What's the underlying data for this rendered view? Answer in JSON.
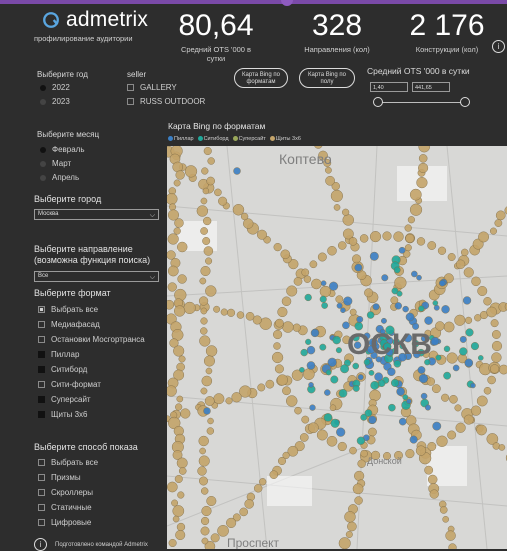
{
  "brand": {
    "name": "admetrix",
    "subtitle": "профилирование аудитории"
  },
  "kpis": [
    {
      "value": "80,64",
      "label": "Средний OTS '000 в сутки"
    },
    {
      "value": "328",
      "label": "Направления (кол)"
    },
    {
      "value": "2 176",
      "label": "Конструкции (кол)"
    }
  ],
  "filters": {
    "year": {
      "label": "Выберите год",
      "options": [
        "2022",
        "2023"
      ],
      "selected": "2022"
    },
    "seller": {
      "label": "seller",
      "options": [
        "GALLERY",
        "RUSS OUTDOOR"
      ]
    },
    "buttons": {
      "formats": "Карта Bing по форматам",
      "floor": "Карта Bing по полу"
    },
    "ots_slider": {
      "title": "Средний OTS '000 в сутки",
      "min": "1,40",
      "max": "441,65"
    },
    "month": {
      "label": "Выберите месяц",
      "options": [
        "Февраль",
        "Март",
        "Апрель"
      ],
      "selected": "Февраль"
    },
    "city": {
      "label": "Выберите город",
      "value": "Москва"
    },
    "direction": {
      "label": "Выберите направление (возможна функция поиска)",
      "value": "Все"
    },
    "format": {
      "label": "Выберите формат",
      "items": [
        "Выбрать все",
        "Медиафасад",
        "Остановки Мосгортранса",
        "Пиллар",
        "Ситиборд",
        "Сити-формат",
        "Суперсайт",
        "Щиты 3х6"
      ]
    },
    "display": {
      "label": "Выберите способ показа",
      "items": [
        "Выбрать все",
        "Призмы",
        "Скроллеры",
        "Статичные",
        "Цифровые"
      ]
    }
  },
  "map": {
    "title": "Карта Bing по форматам",
    "legend": [
      {
        "name": "Пиллар",
        "color": "#3b7fc4"
      },
      {
        "name": "Ситиборд",
        "color": "#1fa89a"
      },
      {
        "name": "Суперсайт",
        "color": "#9aa85a"
      },
      {
        "name": "Щиты 3х6",
        "color": "#c4a46a"
      }
    ],
    "places": {
      "koptevo": "Коптево",
      "moscow": "ОСКВ",
      "donskoy": "Донской",
      "prospekt": "Проспект"
    }
  },
  "footer": {
    "text": "Подготовлено командой Admetrix",
    "icon": "info-icon"
  },
  "colors": {
    "background": "#2d2d2d",
    "accent": "#7a4aa8",
    "bluedot": "#3b7fc4",
    "tealdot": "#1fa89a",
    "tandot": "#c4a46a"
  }
}
